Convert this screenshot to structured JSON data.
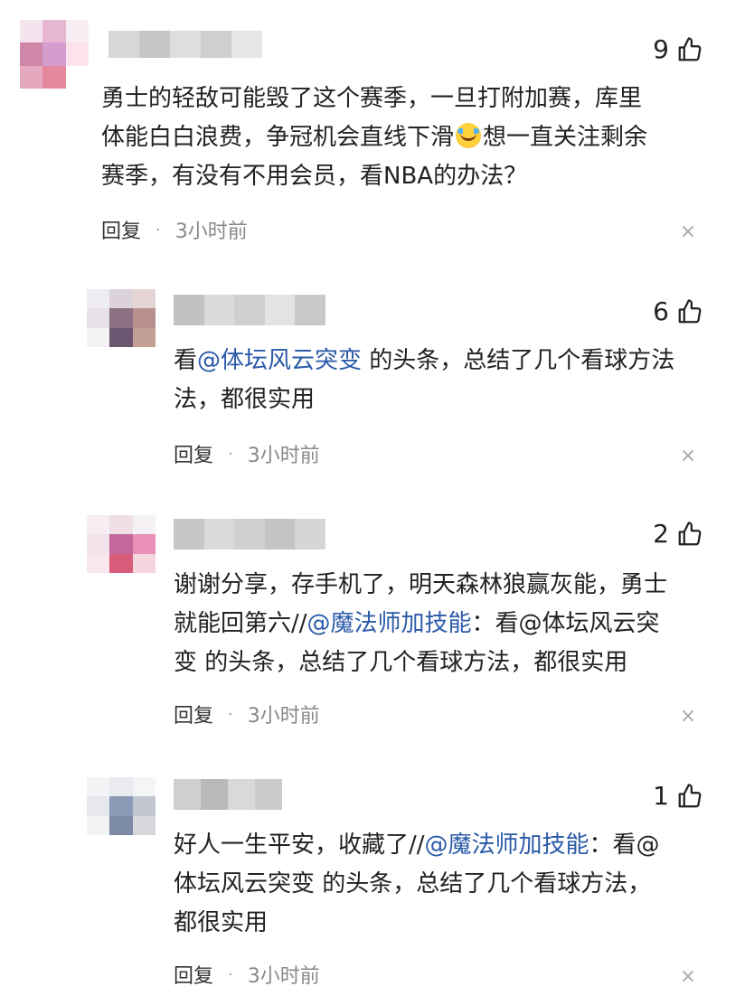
{
  "comments": [
    {
      "likes": "9",
      "text_lines": [
        "勇士的轻敌可能毁了这个赛季，一旦打附加赛，库里",
        "体能白白浪费，争冠机会直线下滑",
        "想一直关注剩余",
        "赛季，有没有不用会员，看NBA的办法？"
      ],
      "reply_label": "回复",
      "separator": "·",
      "time": "3小时前"
    }
  ],
  "replies": [
    {
      "likes": "6",
      "line1_pre": "看",
      "line1_mention": "@体坛风云突变",
      "line1_post": " 的头条，总结了几个看球方法",
      "line2": "法，都很实用",
      "reply_label": "回复",
      "separator": "·",
      "time": "3小时前"
    },
    {
      "likes": "2",
      "line1": "谢谢分享，存手机了，明天森林狼赢灰能，勇士",
      "line2_pre": "就能回第六//",
      "line2_mention": "@魔法师加技能",
      "line2_post": "：看@体坛风云突",
      "line3": "变 的头条，总结了几个看球方法，都很实用",
      "reply_label": "回复",
      "separator": "·",
      "time": "3小时前"
    },
    {
      "likes": "1",
      "line1_pre": "好人一生平安，收藏了//",
      "line1_mention": "@魔法师加技能",
      "line1_post": "：看@",
      "line2": "体坛风云突变 的头条，总结了几个看球方法，",
      "line3": "都很实用",
      "reply_label": "回复",
      "separator": "·",
      "time": "3小时前"
    }
  ],
  "icons": {
    "like": "thumbs-up-icon",
    "close": "close-icon",
    "emoji": "laughing-tears-emoji-icon"
  },
  "colors": {
    "mention": "#2a5aa8",
    "text": "#222222",
    "time": "#888888"
  }
}
